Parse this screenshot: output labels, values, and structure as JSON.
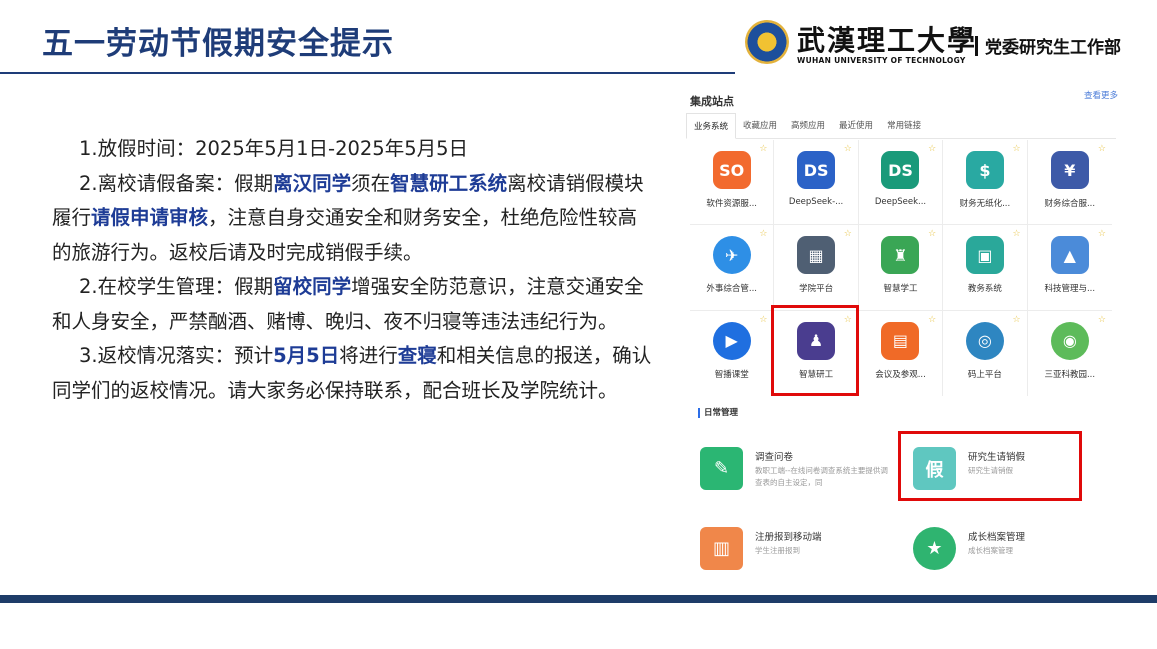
{
  "header": {
    "title": "五一劳动节假期安全提示",
    "university_cn": "武漢理工大學",
    "university_en": "WUHAN UNIVERSITY OF TECHNOLOGY",
    "department": "党委研究生工作部"
  },
  "notice": {
    "p1": "1.放假时间：2025年5月1日-2025年5月5日",
    "p2_a": "2.离校请假备案：假期",
    "p2_b": "离汉同学",
    "p2_c": "须在",
    "p2_d": "智慧研工系统",
    "p2_e": "离校请销假模块履行",
    "p2_f": "请假申请审核",
    "p2_g": "，注意自身交通安全和财务安全，杜绝危险性较高的旅游行为。返校后请及时完成销假手续。",
    "p3_a": "2.在校学生管理：假期",
    "p3_b": "留校同学",
    "p3_c": "增强安全防范意识，注意交通安全和人身安全，严禁酗酒、赌博、晚归、夜不归寝等违法违纪行为。",
    "p4_a": "3.返校情况落实：预计",
    "p4_b": "5月5日",
    "p4_c": "将进行",
    "p4_d": "查寝",
    "p4_e": "和相关信息的报送，确认同学们的返校情况。请大家务必保持联系，配合班长及学院统计。"
  },
  "portal": {
    "title": "集成站点",
    "view_more": "查看更多",
    "tabs": [
      "业务系统",
      "收藏应用",
      "高频应用",
      "最近使用",
      "常用链接"
    ],
    "apps": [
      {
        "label": "软件资源服...",
        "glyph": "SO",
        "color": "#f26a2e"
      },
      {
        "label": "DeepSeek-...",
        "glyph": "DS",
        "color": "#2b62c7"
      },
      {
        "label": "DeepSeek...",
        "glyph": "DS",
        "color": "#1a9a7a"
      },
      {
        "label": "财务无纸化...",
        "glyph": "$",
        "color": "#29a9a2"
      },
      {
        "label": "财务综合服...",
        "glyph": "¥",
        "color": "#3d5aa8"
      },
      {
        "label": "外事综合管...",
        "glyph": "✈",
        "color": "#2e8fe6"
      },
      {
        "label": "学院平台",
        "glyph": "▦",
        "color": "#4f5f73"
      },
      {
        "label": "智慧学工",
        "glyph": "♜",
        "color": "#3aa655"
      },
      {
        "label": "教务系统",
        "glyph": "▣",
        "color": "#2aa89a"
      },
      {
        "label": "科技管理与...",
        "glyph": "▲",
        "color": "#4b8bd9"
      },
      {
        "label": "智播课堂",
        "glyph": "▶",
        "color": "#1f6fe0"
      },
      {
        "label": "智慧研工",
        "glyph": "♟",
        "color": "#4a3d8f"
      },
      {
        "label": "会议及参观...",
        "glyph": "▤",
        "color": "#f06a27"
      },
      {
        "label": "码上平台",
        "glyph": "◎",
        "color": "#2e86c1"
      },
      {
        "label": "三亚科教园...",
        "glyph": "◉",
        "color": "#5dbb5a"
      }
    ],
    "daily_title": "日常管理",
    "daily": [
      {
        "name": "调查问卷",
        "desc": "教职工端--在线问卷调查系统主要提供调查表的自主设定，同",
        "glyph": "✎",
        "color": "#2bb673"
      },
      {
        "name": "研究生请销假",
        "desc": "研究生请销假",
        "glyph": "假",
        "color": "#5fc7c0"
      },
      {
        "name": "注册报到移动端",
        "desc": "学生注册报到",
        "glyph": "▥",
        "color": "#f0874a"
      },
      {
        "name": "成长档案管理",
        "desc": "成长档案管理",
        "glyph": "★",
        "color": "#2fb470"
      }
    ]
  }
}
